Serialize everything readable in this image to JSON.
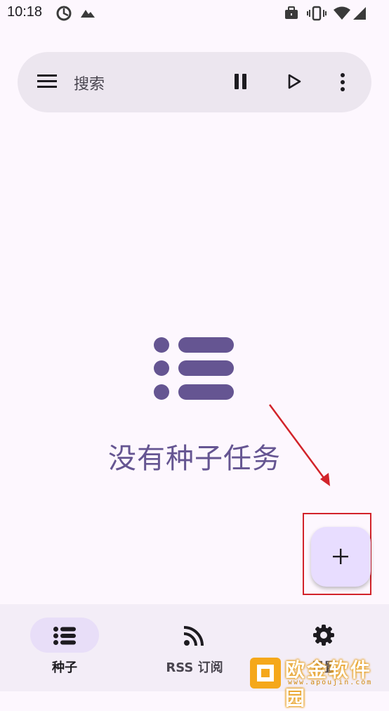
{
  "status_bar": {
    "time": "10:18",
    "icons": [
      "data-saver-icon",
      "mountain-icon",
      "briefcase-icon",
      "vibrate-icon",
      "wifi-icon",
      "signal-icon"
    ]
  },
  "search_bar": {
    "placeholder": "搜索",
    "menu_icon": "hamburger-menu-icon",
    "pause_icon": "pause-all-icon",
    "play_icon": "resume-all-icon",
    "more_icon": "more-vert-icon"
  },
  "empty_state": {
    "icon": "list-icon",
    "message": "没有种子任务"
  },
  "fab": {
    "icon": "plus-icon"
  },
  "bottom_nav": {
    "items": [
      {
        "label": "种子",
        "icon": "list-icon",
        "active": true
      },
      {
        "label": "RSS 订阅",
        "icon": "rss-icon",
        "active": false
      },
      {
        "label": "设置",
        "icon": "gear-icon",
        "active": false
      }
    ]
  },
  "watermark": {
    "text": "欧金软件园",
    "url_text": "www.apoujin.com"
  },
  "colors": {
    "background": "#fdf7fe",
    "search_bg": "#ece6ef",
    "accent": "#655592",
    "fab_bg": "#e8ddff",
    "annotation_red": "#d2232a"
  }
}
